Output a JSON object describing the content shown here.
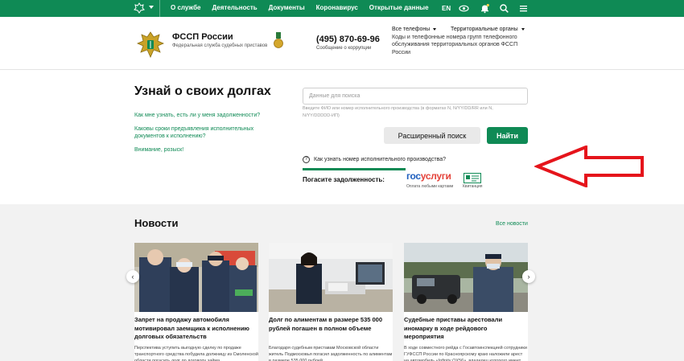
{
  "topnav": {
    "items": [
      "О службе",
      "Деятельность",
      "Документы",
      "Коронавирус",
      "Открытые данные"
    ],
    "lang": "EN",
    "icons": [
      "eye-icon",
      "bell-icon",
      "search-icon",
      "menu-icon"
    ]
  },
  "header": {
    "org_name": "ФССП России",
    "org_sub": "Федеральная служба судебных приставов",
    "phone": "(495) 870-69-96",
    "phone_sub": "Сообщение о коррупции",
    "dd_phones": "Все телефоны",
    "dd_territorial": "Территориальные органы",
    "codes_text": "Коды и телефонные номера групп телефонного обслуживания территориальных органов ФССП России"
  },
  "hero": {
    "title": "Узнай о своих долгах",
    "links": [
      "Как мне узнать, есть ли у меня задолженности?",
      "Каковы сроки предъявления исполнительных документов к исполнению?",
      "Внимание, розыск!"
    ],
    "search_placeholder": "Данные для поиска",
    "hint": "Введите ФИО или номер исполнительного производства (в форматах N, N/YY/DD/RR или N, N/YY/DDDDD-ИП)",
    "btn_advanced": "Расширенный поиск",
    "btn_find": "Найти",
    "how_to": "Как узнать номер исполнительного производства?",
    "pay_label": "Погасите задолженность:",
    "gos_part1": "гос",
    "gos_part2": "услуги",
    "gos_sub": "Оплата любыми картами",
    "kvit_sub": "Квитанция"
  },
  "news": {
    "title": "Новости",
    "all_link": "Все новости",
    "cards": [
      {
        "title": "Запрет на продажу автомобиля мотивировал заемщика к исполнению долговых обязательств",
        "text": "Перспектива уступить выгодную сделку по продаже транспортного средства побудила должницу из Смоленской области погасить долг по договору займа"
      },
      {
        "title": "Долг по алиментам в размере 535 000 рублей погашен в полном объеме",
        "text": "Благодаря судебным приставам Московской области житель Подмосковья погасил задолженность по алиментам в размере 535 000 рублей."
      },
      {
        "title": "Судебные приставы арестовали иномарку в ходе рейдового мероприятия",
        "text": "В ходе совместного рейда с Госавтоинспекцией сотрудники ГУФССП России по Красноярскому краю наложили арест на автомобиль «Infinity QX56», владелец которого имеет неоплаченные кредитные обязательства"
      }
    ]
  },
  "colors": {
    "brand_green": "#0f8a55",
    "arrow_red": "#e5141b",
    "gos_blue": "#1f5fbe",
    "gos_red": "#e4433b"
  }
}
